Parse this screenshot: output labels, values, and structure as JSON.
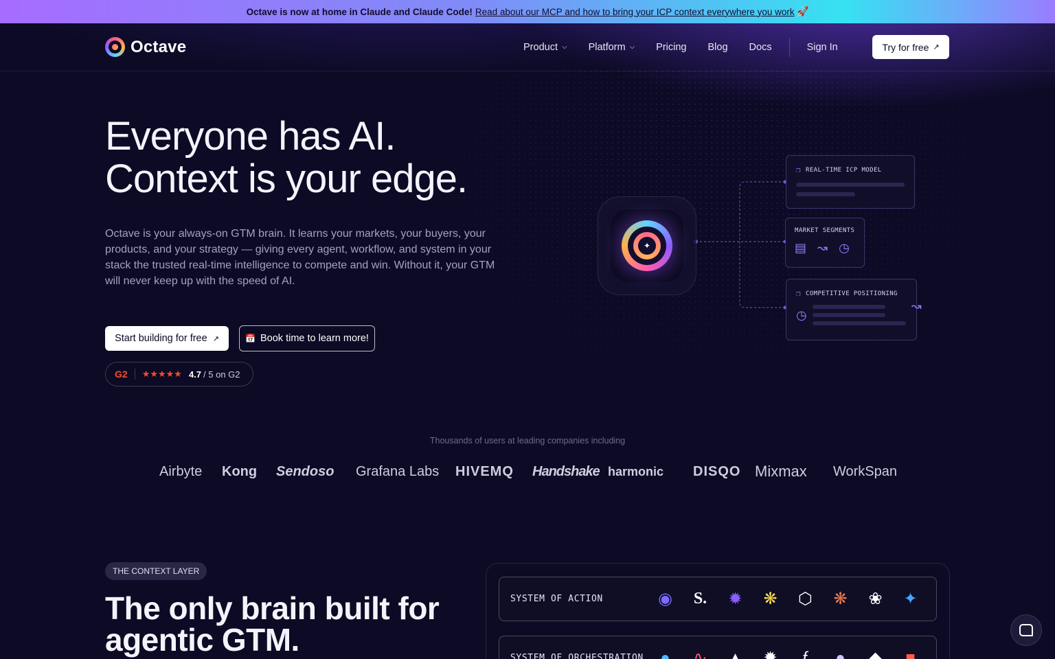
{
  "announcement": {
    "lead": "Octave is now at home in Claude and Claude Code!",
    "link": "Read about our MCP and how to bring your ICP context everywhere you work",
    "emoji": "🚀"
  },
  "nav": {
    "brand": "Octave",
    "links": [
      {
        "label": "Product",
        "dropdown": true
      },
      {
        "label": "Platform",
        "dropdown": true
      },
      {
        "label": "Pricing",
        "dropdown": false
      },
      {
        "label": "Blog",
        "dropdown": false
      },
      {
        "label": "Docs",
        "dropdown": false
      }
    ],
    "sign_in": "Sign In",
    "try_free": "Try for free"
  },
  "hero": {
    "headline_1": "Everyone has AI.",
    "headline_2": "Context is your edge.",
    "description": "Octave is your always-on GTM brain. It learns your markets, your buyers, your products, and your strategy — giving every agent, workflow, and system in your stack the trusted real-time intelligence to compete and win. Without it, your GTM will never keep up with the speed of AI.",
    "primary_cta": "Start building for free",
    "secondary_cta": "Book time to learn more!",
    "g2": {
      "logo": "G2",
      "stars": "★★★★★",
      "rating": "4.7",
      "suffix": "/ 5 on G2"
    }
  },
  "diagram": {
    "cards": [
      {
        "label": "REAL-TIME ICP MODEL"
      },
      {
        "label": "MARKET SEGMENTS"
      },
      {
        "label": "COMPETITIVE POSITIONING"
      }
    ]
  },
  "customers": {
    "label": "Thousands of users at leading companies including",
    "logos": [
      "Airbyte",
      "Kong",
      "Sendoso",
      "Grafana Labs",
      "HIVEMQ",
      "Handshake",
      "harmonic",
      "DISQO",
      "Mixmax",
      "WorkSpan"
    ]
  },
  "context_layer": {
    "badge": "THE CONTEXT LAYER",
    "title_1": "The only brain built for",
    "title_2": "agentic GTM.",
    "rows": [
      {
        "label": "SYSTEM OF ACTION"
      },
      {
        "label": "SYSTEM OF ORCHESTRATION"
      }
    ]
  },
  "colors": {
    "background": "#0c0a24",
    "accent": "#8e5bff",
    "g2": "#ff492c"
  }
}
